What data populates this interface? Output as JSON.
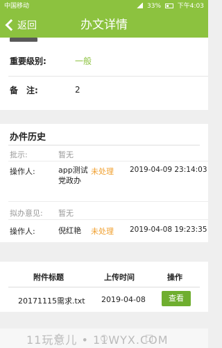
{
  "status_bar": {
    "carrier": "中国移动",
    "battery": "33%",
    "time": "下午4:03"
  },
  "header": {
    "back_label": "返回",
    "title": "办文详情"
  },
  "details": {
    "level_label": "重要级别:",
    "level_value": "一般",
    "remark_label": "备　注:",
    "remark_value": "2"
  },
  "history": {
    "title": "办件历史",
    "entries": [
      {
        "comment_label": "批示:",
        "comment_value": "暂无",
        "operator_label": "操作人:",
        "operator": "app测试党政办",
        "status": "未处理",
        "time": "2019-04-09 23:14:03"
      },
      {
        "comment_label": "拟办意见:",
        "comment_value": "暂无",
        "operator_label": "操作人:",
        "operator": "倪红艳",
        "status": "未处理",
        "time": "2019-04-08 19:23:35"
      }
    ]
  },
  "attachments": {
    "headers": [
      "附件标题",
      "上传时间",
      "操作"
    ],
    "rows": [
      {
        "name": "20171115需求.txt",
        "date": "2019-04-08",
        "action": "查看"
      }
    ]
  },
  "watermark": "11玩意儿 • 11WYX.COM",
  "colors": {
    "accent": "#8cc23f",
    "status": "#f0a030",
    "button": "#6fae2f"
  }
}
